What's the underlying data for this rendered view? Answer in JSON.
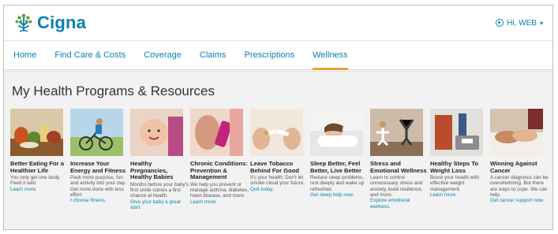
{
  "brand": {
    "name": "Cigna",
    "accent": "#0a7fb4",
    "tab_indicator": "#f39c3c"
  },
  "user_menu": {
    "icon": "user-circle-icon",
    "label": "Hi, WEB",
    "caret": "▾"
  },
  "nav": {
    "tabs": [
      {
        "label": "Home",
        "active": false
      },
      {
        "label": "Find Care & Costs",
        "active": false
      },
      {
        "label": "Coverage",
        "active": false
      },
      {
        "label": "Claims",
        "active": false
      },
      {
        "label": "Prescriptions",
        "active": false
      },
      {
        "label": "Wellness",
        "active": true
      }
    ]
  },
  "page": {
    "title": "My Health Programs & Resources"
  },
  "programs": [
    {
      "title": "Better Eating For a Healthier Life",
      "description": "You only get one body. Feed it well.",
      "link": "Learn more.",
      "image": "food-image"
    },
    {
      "title": "Increase Your Energy and Fitness",
      "description": "Pack more purpose, fun and activity into your day. Get more done with less effort.",
      "link": "I choose fitness.",
      "image": "cyclist-image"
    },
    {
      "title": "Healthy Pregnancies, Healthy Babies",
      "description": "Months before your baby's first smile comes a first chance at health.",
      "link": "Give your baby a great start.",
      "image": "baby-image"
    },
    {
      "title": "Chronic Conditions: Prevention & Management",
      "description": "We help you prevent or manage asthma, diabetes, heart disease, and more.",
      "link": "Learn more.",
      "image": "inhaler-image"
    },
    {
      "title": "Leave Tobacco Behind For Good",
      "description": "It's your health. Don't let smoke cloud your future.",
      "link": "Quit today.",
      "image": "broken-cigarette-image"
    },
    {
      "title": "Sleep Better, Feel Better, Live Better",
      "description": "Reduce sleep problems, rest deeply and wake up refreshed.",
      "link": "Get sleep help now.",
      "image": "sleeping-woman-image"
    },
    {
      "title": "Stress and Emotional Wellness",
      "description": "Learn to control unnecessary stress and anxiety, build resilience, and more.",
      "link": "Explore emotional wellness.",
      "image": "yoga-image"
    },
    {
      "title": "Healthy Steps To Weight Loss",
      "description": "Boost your health with effective weight management.",
      "link": "Learn more.",
      "image": "scale-image"
    },
    {
      "title": "Winning Against Cancer",
      "description": "A cancer diagnosis can be overwhelming. But there are ways to cope. We can help.",
      "link": "Get cancer support now.",
      "image": "hands-image"
    }
  ]
}
